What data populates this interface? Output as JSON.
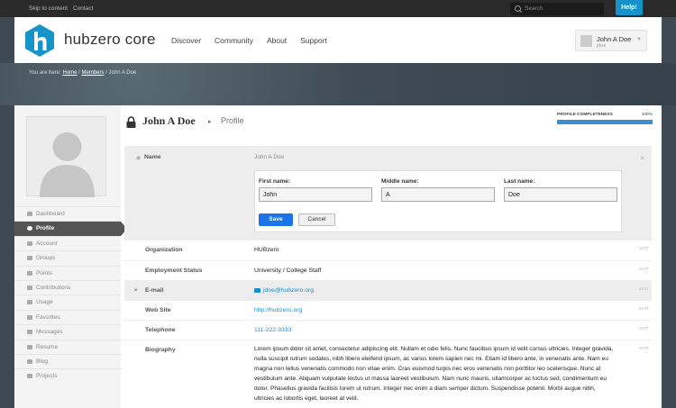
{
  "topbar": {
    "skip": "Skip to content",
    "contact": "Contact",
    "search_placeholder": "Search",
    "help": "Help!"
  },
  "header": {
    "logo_text": "hubzero core",
    "nav": [
      "Discover",
      "Community",
      "About",
      "Support"
    ],
    "user_name": "John A Doe",
    "user_handle": "jdoe"
  },
  "breadcrumb": {
    "prefix": "You are here:",
    "home": "Home",
    "members": "Members",
    "current": "John A Doe"
  },
  "sidebar": {
    "items": [
      "Dashboard",
      "Profile",
      "Account",
      "Groups",
      "Points",
      "Contributions",
      "Usage",
      "Favorites",
      "Messages",
      "Resume",
      "Blog",
      "Projects"
    ],
    "active": "Profile"
  },
  "page": {
    "title": "John A Doe",
    "separator": "▸",
    "subtitle": "Profile"
  },
  "completeness": {
    "label": "PROFILE COMPLETENESS",
    "percent_text": "100%",
    "value": 1.0
  },
  "name_panel": {
    "label": "Name",
    "value": "John A Doe",
    "first_label": "First name:",
    "first_value": "John",
    "middle_label": "Middle name:",
    "middle_value": "A",
    "last_label": "Last name:",
    "last_value": "Doe",
    "save": "Save",
    "cancel": "Cancel",
    "close": "×"
  },
  "fields": {
    "edit": "EDIT",
    "organization": {
      "label": "Organization",
      "value": "HUBzero"
    },
    "employment": {
      "label": "Employment Status",
      "value": "University / College Staff"
    },
    "email": {
      "label": "E-mail",
      "value": "jdoe@hubzero.org"
    },
    "website": {
      "label": "Web Site",
      "value": "http://hubzero.org"
    },
    "telephone": {
      "label": "Telephone",
      "value": "111-222-3333"
    },
    "biography": {
      "label": "Biography",
      "value": "Lorem ipsum dolor sit amet, consectetur adipiscing elit. Nullam et odio felis. Nunc faucibus ipsum id velit cursus ultricies. Integer gravida, nulla suscipit rutrum sodales, nibh libero eleifend ipsum, ac varius lorem sapien nec mi. Etiam id libero ante, in venenatis ante. Nam eu magna non tellus venenatis commodo non vitae enim. Cras euismod turpis nec eros venenatis non porttitor leo scelerisque. Nunc at vestibulum ante. Aliquam vulputate lectus ut massa laoreet vestibulum. Nam nunc mauris, ullamcorper ac luctus sed, condimentum eu dolor. Phasellus gravida facilisis lorem ut rutrum. Integer nec enim a diam semper dictum. Suspendisse potenti. Morbi augue nibh, ultricies ac lobortis eget, laoreet at velit."
    }
  },
  "colors": {
    "accent": "#1694c9",
    "save_button": "#1a73e8",
    "link": "#1a8fd0",
    "progress": "#3b8ed6"
  }
}
